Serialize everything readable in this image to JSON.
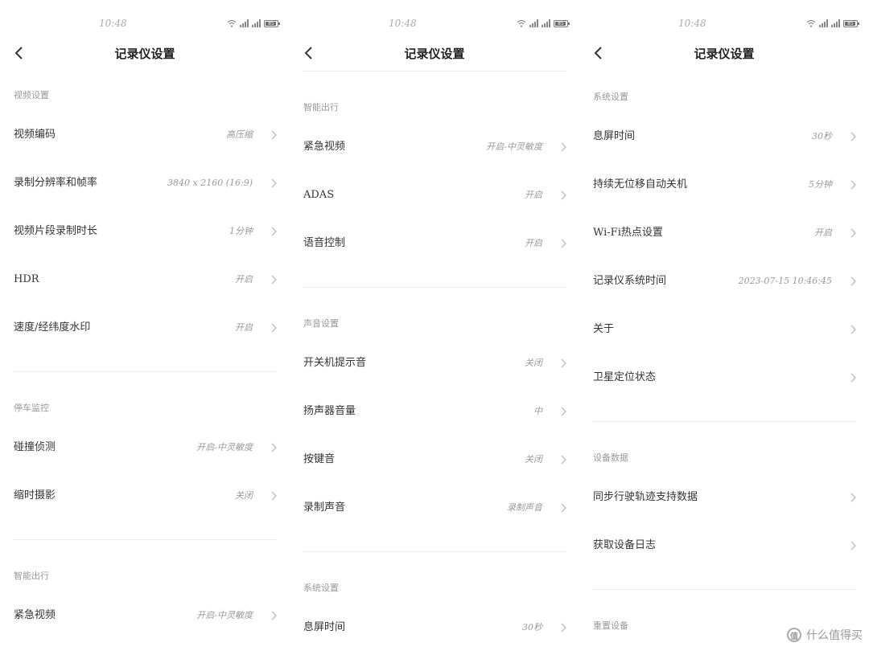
{
  "status": {
    "time": "10:48",
    "battery": "85"
  },
  "header": {
    "title": "记录仪设置"
  },
  "panel1": {
    "s1_title": "视频设置",
    "rows": [
      {
        "label": "视频编码",
        "value": "高压缩"
      },
      {
        "label": "录制分辨率和帧率",
        "value": "3840 x 2160 (16:9)"
      },
      {
        "label": "视频片段录制时长",
        "value": "1分钟"
      },
      {
        "label": "HDR",
        "value": "开启"
      },
      {
        "label": "速度/经纬度水印",
        "value": "开启"
      }
    ],
    "s2_title": "停车监控",
    "rows2": [
      {
        "label": "碰撞侦测",
        "value": "开启-中灵敏度"
      },
      {
        "label": "缩时摄影",
        "value": "关闭"
      }
    ],
    "s3_title": "智能出行",
    "rows3": [
      {
        "label": "紧急视频",
        "value": "开启-中灵敏度"
      }
    ]
  },
  "panel2": {
    "s1_title": "智能出行",
    "rows": [
      {
        "label": "紧急视频",
        "value": "开启-中灵敏度"
      },
      {
        "label": "ADAS",
        "value": "开启"
      },
      {
        "label": "语音控制",
        "value": "开启"
      }
    ],
    "s2_title": "声音设置",
    "rows2": [
      {
        "label": "开关机提示音",
        "value": "关闭"
      },
      {
        "label": "扬声器音量",
        "value": "中"
      },
      {
        "label": "按键音",
        "value": "关闭"
      },
      {
        "label": "录制声音",
        "value": "录制声音"
      }
    ],
    "s3_title": "系统设置",
    "rows3": [
      {
        "label": "息屏时间",
        "value": "30秒"
      }
    ]
  },
  "panel3": {
    "s1_title": "系统设置",
    "rows": [
      {
        "label": "息屏时间",
        "value": "30秒"
      },
      {
        "label": "持续无位移自动关机",
        "value": "5分钟"
      },
      {
        "label": "Wi-Fi热点设置",
        "value": "开启"
      },
      {
        "label": "记录仪系统时间",
        "value": "2023-07-15 10:46:45"
      },
      {
        "label": "关于",
        "value": ""
      },
      {
        "label": "卫星定位状态",
        "value": ""
      }
    ],
    "s2_title": "设备数据",
    "rows2": [
      {
        "label": "同步行驶轨迹支持数据",
        "value": ""
      },
      {
        "label": "获取设备日志",
        "value": ""
      }
    ],
    "s3_title": "重置设备"
  },
  "watermark": {
    "logo": "值",
    "text": "什么值得买"
  },
  "icons": {
    "back": "chevron-left-icon",
    "row": "chevron-right-icon",
    "wifi": "wifi-icon",
    "signal": "signal-icon",
    "battery": "battery-icon"
  },
  "colors": {
    "background": "#ffffff",
    "divider": "#ececec",
    "label": "#333333",
    "value": "#999999"
  }
}
